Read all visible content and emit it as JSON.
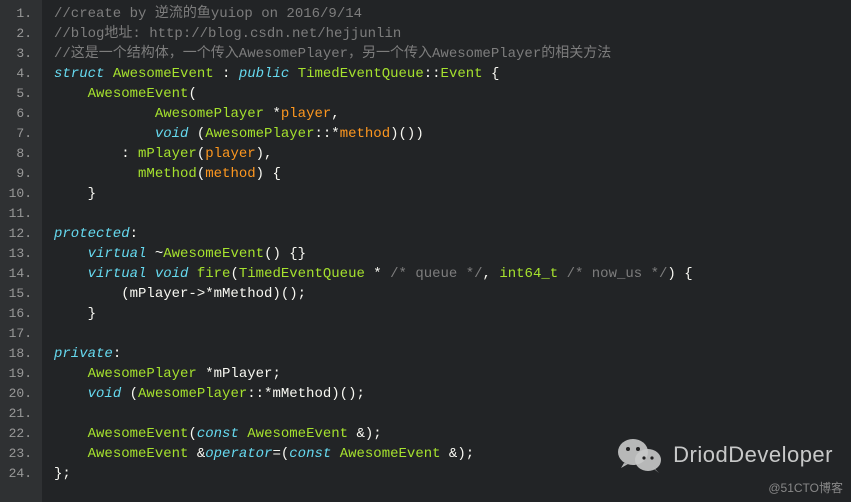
{
  "lines": [
    {
      "n": "1.",
      "segs": [
        {
          "cls": "c-comment",
          "t": "//create by 逆流的鱼yuiop on 2016/9/14"
        }
      ]
    },
    {
      "n": "2.",
      "segs": [
        {
          "cls": "c-comment",
          "t": "//blog地址: http://blog.csdn.net/hejjunlin"
        }
      ]
    },
    {
      "n": "3.",
      "segs": [
        {
          "cls": "c-comment",
          "t": "//这是一个结构体，一个传入AwesomePlayer，另一个传入AwesomePlayer的相关方法"
        }
      ]
    },
    {
      "n": "4.",
      "segs": [
        {
          "cls": "c-keyword",
          "t": "struct"
        },
        {
          "cls": "c-plain",
          "t": " "
        },
        {
          "cls": "c-type",
          "t": "AwesomeEvent"
        },
        {
          "cls": "c-plain",
          "t": " : "
        },
        {
          "cls": "c-keyword",
          "t": "public"
        },
        {
          "cls": "c-plain",
          "t": " "
        },
        {
          "cls": "c-type",
          "t": "TimedEventQueue"
        },
        {
          "cls": "c-plain",
          "t": "::"
        },
        {
          "cls": "c-type",
          "t": "Event"
        },
        {
          "cls": "c-plain",
          "t": " {"
        }
      ]
    },
    {
      "n": "5.",
      "segs": [
        {
          "cls": "c-plain",
          "t": "    "
        },
        {
          "cls": "c-func",
          "t": "AwesomeEvent"
        },
        {
          "cls": "c-plain",
          "t": "("
        }
      ]
    },
    {
      "n": "6.",
      "segs": [
        {
          "cls": "c-plain",
          "t": "            "
        },
        {
          "cls": "c-type",
          "t": "AwesomePlayer"
        },
        {
          "cls": "c-plain",
          "t": " *"
        },
        {
          "cls": "c-param",
          "t": "player"
        },
        {
          "cls": "c-plain",
          "t": ","
        }
      ]
    },
    {
      "n": "7.",
      "segs": [
        {
          "cls": "c-plain",
          "t": "            "
        },
        {
          "cls": "c-keyword",
          "t": "void"
        },
        {
          "cls": "c-plain",
          "t": " ("
        },
        {
          "cls": "c-type",
          "t": "AwesomePlayer"
        },
        {
          "cls": "c-plain",
          "t": "::*"
        },
        {
          "cls": "c-param",
          "t": "method"
        },
        {
          "cls": "c-plain",
          "t": ")())"
        }
      ]
    },
    {
      "n": "8.",
      "segs": [
        {
          "cls": "c-plain",
          "t": "        : "
        },
        {
          "cls": "c-func",
          "t": "mPlayer"
        },
        {
          "cls": "c-plain",
          "t": "("
        },
        {
          "cls": "c-param",
          "t": "player"
        },
        {
          "cls": "c-plain",
          "t": "),"
        }
      ]
    },
    {
      "n": "9.",
      "segs": [
        {
          "cls": "c-plain",
          "t": "          "
        },
        {
          "cls": "c-func",
          "t": "mMethod"
        },
        {
          "cls": "c-plain",
          "t": "("
        },
        {
          "cls": "c-param",
          "t": "method"
        },
        {
          "cls": "c-plain",
          "t": ") {"
        }
      ]
    },
    {
      "n": "10.",
      "segs": [
        {
          "cls": "c-plain",
          "t": "    }"
        }
      ]
    },
    {
      "n": "11.",
      "segs": [
        {
          "cls": "c-plain",
          "t": ""
        }
      ]
    },
    {
      "n": "12.",
      "segs": [
        {
          "cls": "c-keyword",
          "t": "protected"
        },
        {
          "cls": "c-plain",
          "t": ":"
        }
      ]
    },
    {
      "n": "13.",
      "segs": [
        {
          "cls": "c-plain",
          "t": "    "
        },
        {
          "cls": "c-keyword",
          "t": "virtual"
        },
        {
          "cls": "c-plain",
          "t": " ~"
        },
        {
          "cls": "c-func",
          "t": "AwesomeEvent"
        },
        {
          "cls": "c-plain",
          "t": "() {}"
        }
      ]
    },
    {
      "n": "14.",
      "segs": [
        {
          "cls": "c-plain",
          "t": "    "
        },
        {
          "cls": "c-keyword",
          "t": "virtual"
        },
        {
          "cls": "c-plain",
          "t": " "
        },
        {
          "cls": "c-keyword",
          "t": "void"
        },
        {
          "cls": "c-plain",
          "t": " "
        },
        {
          "cls": "c-func",
          "t": "fire"
        },
        {
          "cls": "c-plain",
          "t": "("
        },
        {
          "cls": "c-type",
          "t": "TimedEventQueue"
        },
        {
          "cls": "c-plain",
          "t": " * "
        },
        {
          "cls": "c-blockcm",
          "t": "/* queue */"
        },
        {
          "cls": "c-plain",
          "t": ", "
        },
        {
          "cls": "c-type",
          "t": "int64_t"
        },
        {
          "cls": "c-plain",
          "t": " "
        },
        {
          "cls": "c-blockcm",
          "t": "/* now_us */"
        },
        {
          "cls": "c-plain",
          "t": ") {"
        }
      ]
    },
    {
      "n": "15.",
      "segs": [
        {
          "cls": "c-plain",
          "t": "        (mPlayer->*mMethod)();"
        }
      ]
    },
    {
      "n": "16.",
      "segs": [
        {
          "cls": "c-plain",
          "t": "    }"
        }
      ]
    },
    {
      "n": "17.",
      "segs": [
        {
          "cls": "c-plain",
          "t": ""
        }
      ]
    },
    {
      "n": "18.",
      "segs": [
        {
          "cls": "c-keyword",
          "t": "private"
        },
        {
          "cls": "c-plain",
          "t": ":"
        }
      ]
    },
    {
      "n": "19.",
      "segs": [
        {
          "cls": "c-plain",
          "t": "    "
        },
        {
          "cls": "c-type",
          "t": "AwesomePlayer"
        },
        {
          "cls": "c-plain",
          "t": " *mPlayer;"
        }
      ]
    },
    {
      "n": "20.",
      "segs": [
        {
          "cls": "c-plain",
          "t": "    "
        },
        {
          "cls": "c-keyword",
          "t": "void"
        },
        {
          "cls": "c-plain",
          "t": " ("
        },
        {
          "cls": "c-type",
          "t": "AwesomePlayer"
        },
        {
          "cls": "c-plain",
          "t": "::*mMethod)();"
        }
      ]
    },
    {
      "n": "21.",
      "segs": [
        {
          "cls": "c-plain",
          "t": ""
        }
      ]
    },
    {
      "n": "22.",
      "segs": [
        {
          "cls": "c-plain",
          "t": "    "
        },
        {
          "cls": "c-func",
          "t": "AwesomeEvent"
        },
        {
          "cls": "c-plain",
          "t": "("
        },
        {
          "cls": "c-keyword",
          "t": "const"
        },
        {
          "cls": "c-plain",
          "t": " "
        },
        {
          "cls": "c-type",
          "t": "AwesomeEvent"
        },
        {
          "cls": "c-plain",
          "t": " &);"
        }
      ]
    },
    {
      "n": "23.",
      "segs": [
        {
          "cls": "c-plain",
          "t": "    "
        },
        {
          "cls": "c-type",
          "t": "AwesomeEvent"
        },
        {
          "cls": "c-plain",
          "t": " &"
        },
        {
          "cls": "c-keyword",
          "t": "operator"
        },
        {
          "cls": "c-plain",
          "t": "=("
        },
        {
          "cls": "c-keyword",
          "t": "const"
        },
        {
          "cls": "c-plain",
          "t": " "
        },
        {
          "cls": "c-type",
          "t": "AwesomeEvent"
        },
        {
          "cls": "c-plain",
          "t": " &);"
        }
      ]
    },
    {
      "n": "24.",
      "segs": [
        {
          "cls": "c-plain",
          "t": "};"
        }
      ]
    }
  ],
  "watermark_text": "DriodDeveloper",
  "footer_text": "@51CTO博客"
}
